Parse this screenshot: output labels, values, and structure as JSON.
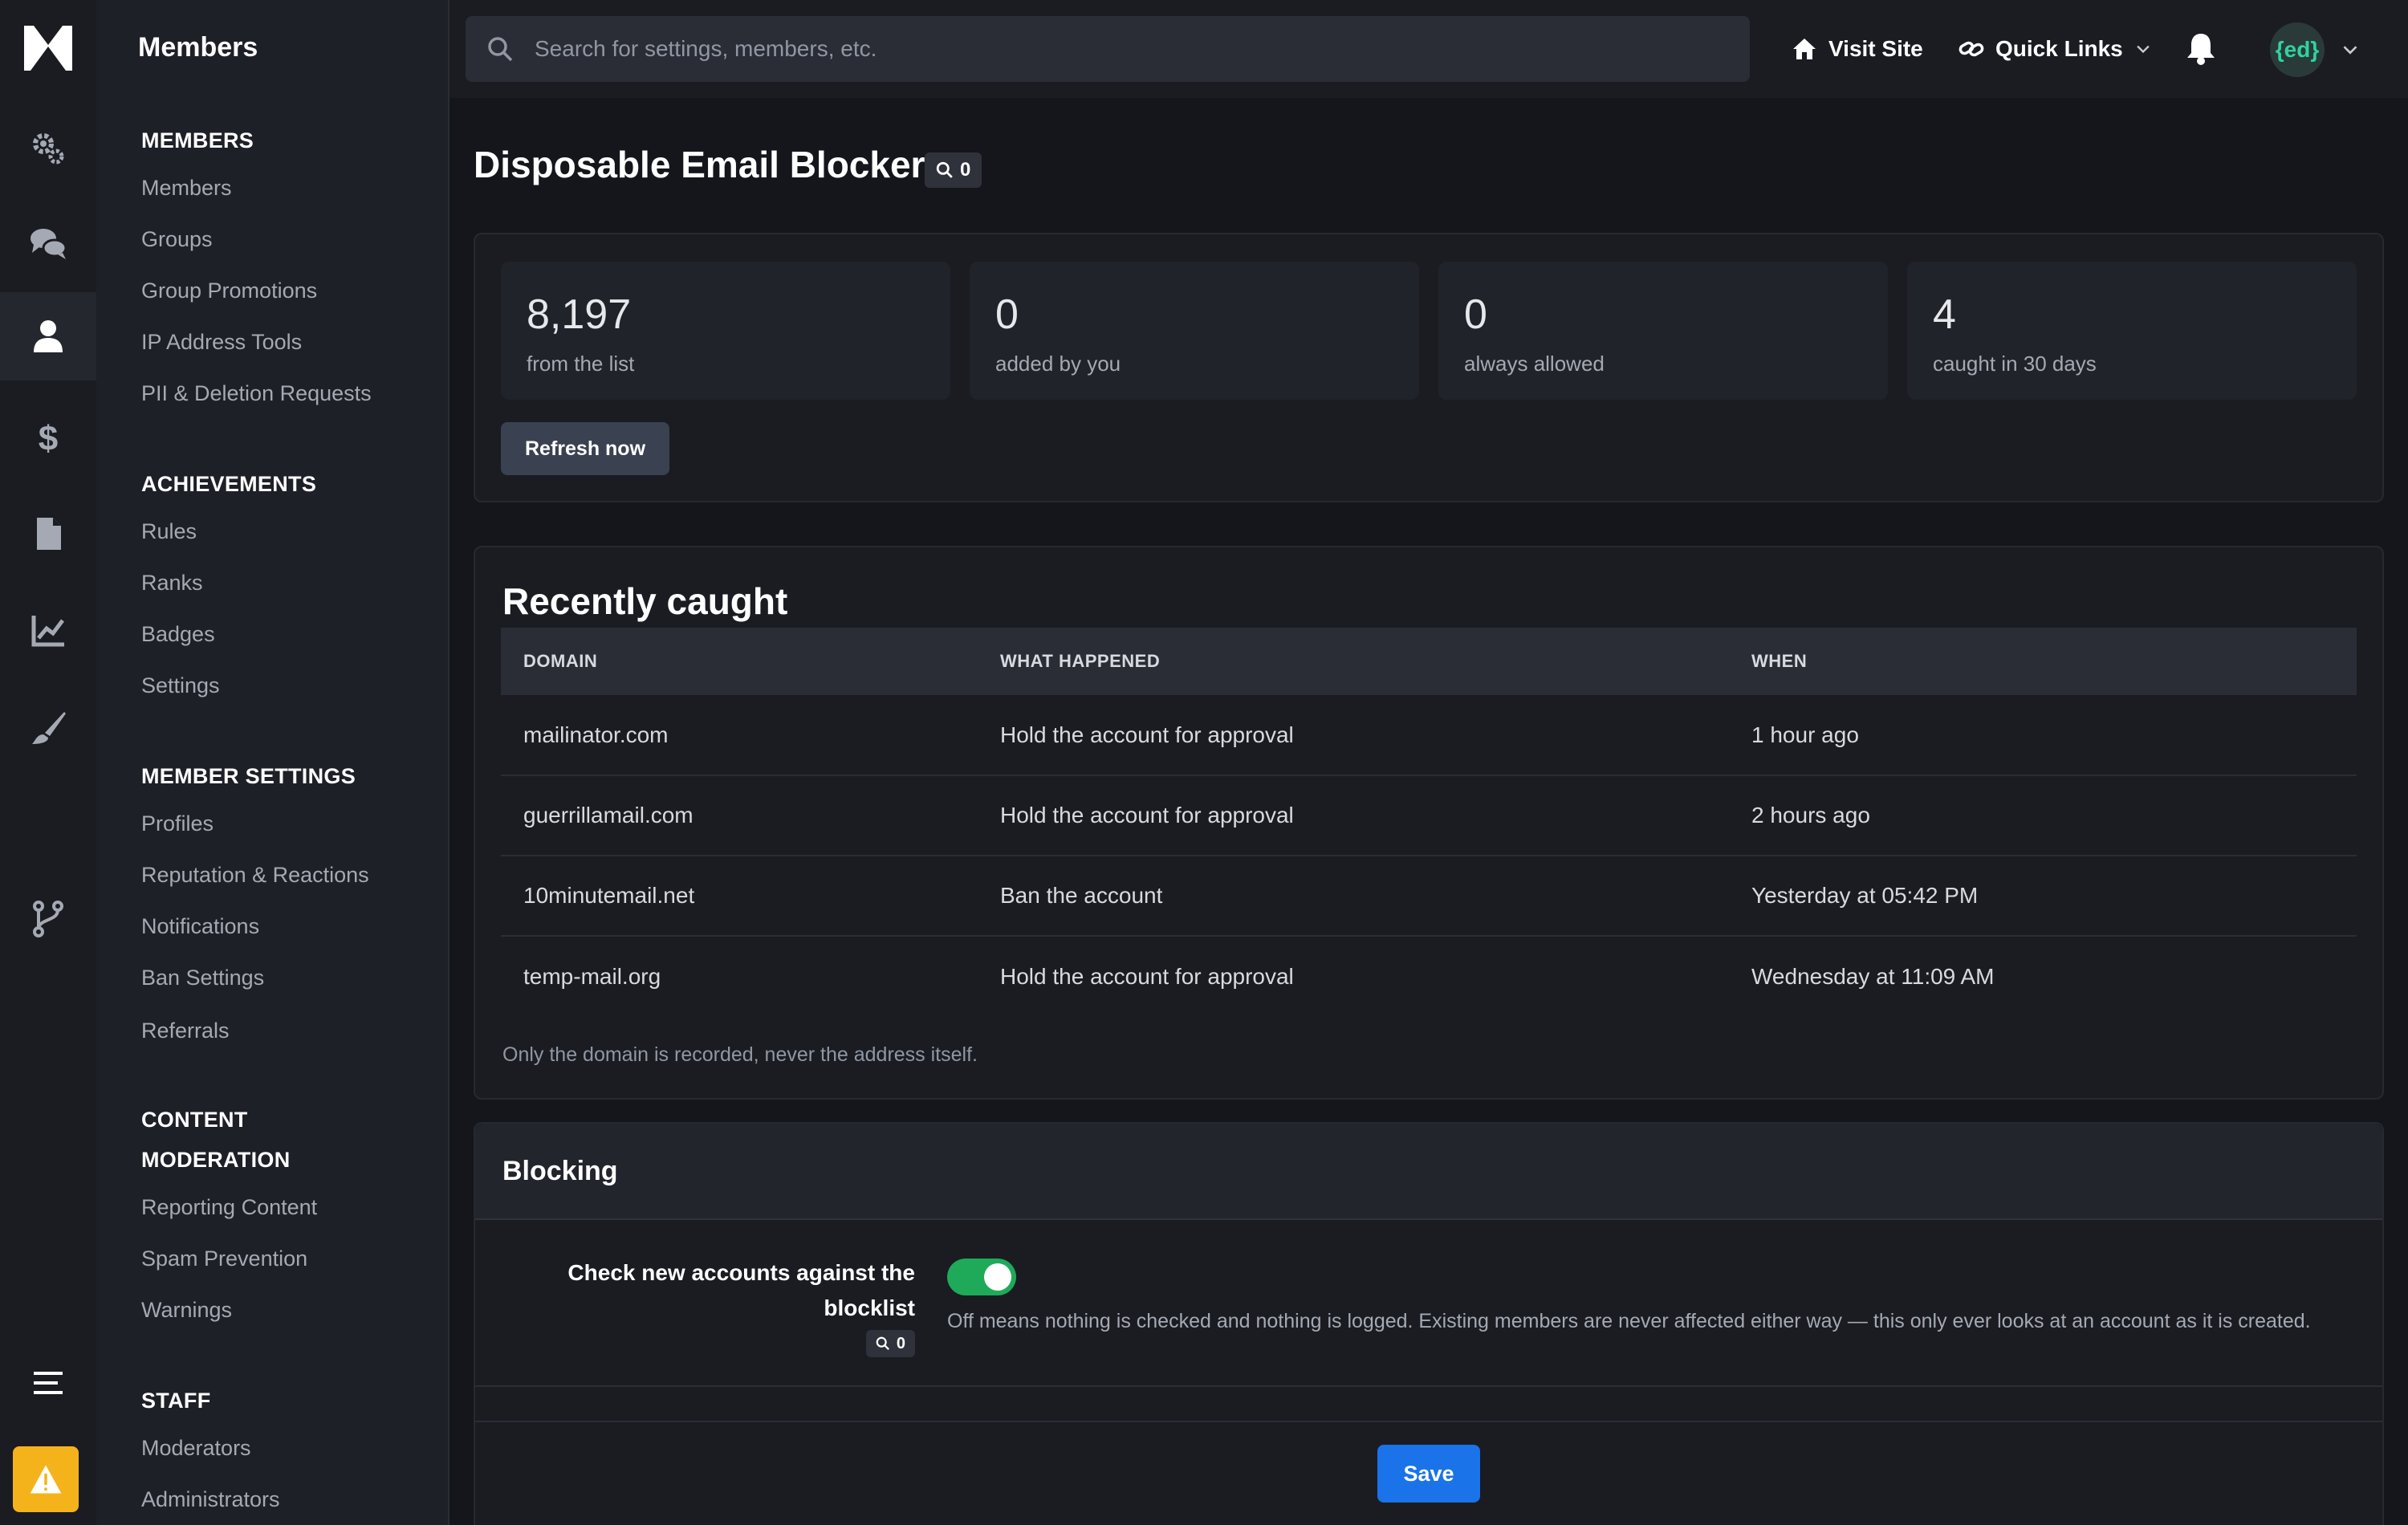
{
  "sidebar": {
    "title": "Members",
    "sections": [
      {
        "heading": "MEMBERS",
        "items": [
          "Members",
          "Groups",
          "Group Promotions",
          "IP Address Tools",
          "PII & Deletion Requests"
        ]
      },
      {
        "heading": "ACHIEVEMENTS",
        "items": [
          "Rules",
          "Ranks",
          "Badges",
          "Settings"
        ]
      },
      {
        "heading": "MEMBER SETTINGS",
        "items": [
          "Profiles",
          "Reputation & Reactions",
          "Notifications",
          "Ban Settings",
          "Referrals"
        ]
      },
      {
        "heading": "CONTENT MODERATION",
        "items": [
          "Reporting Content",
          "Spam Prevention",
          "Warnings"
        ]
      },
      {
        "heading": "STAFF",
        "items": [
          "Moderators",
          "Administrators"
        ]
      }
    ]
  },
  "rail": {
    "icons": [
      "logo-icon",
      "gears-icon",
      "chat-icon",
      "user-icon",
      "dollar-icon",
      "file-icon",
      "chart-icon",
      "brush-icon",
      "branch-icon",
      "menu-icon",
      "warning-icon"
    ],
    "active": "user-icon",
    "alert_color": "#f5b31b"
  },
  "topbar": {
    "search_placeholder": "Search for settings, members, etc.",
    "visit_site": "Visit Site",
    "quick_links": "Quick Links",
    "avatar_text": "{ed}"
  },
  "page": {
    "title": "Disposable Email Blocker",
    "title_badge_count": "0"
  },
  "stats": [
    {
      "value": "8,197",
      "label": "from the list"
    },
    {
      "value": "0",
      "label": "added by you"
    },
    {
      "value": "0",
      "label": "always allowed"
    },
    {
      "value": "4",
      "label": "caught in 30 days"
    }
  ],
  "refresh_label": "Refresh now",
  "recent": {
    "heading": "Recently caught",
    "columns": [
      "DOMAIN",
      "WHAT HAPPENED",
      "WHEN"
    ],
    "rows": [
      [
        "mailinator.com",
        "Hold the account for approval",
        "1 hour ago"
      ],
      [
        "guerrillamail.com",
        "Hold the account for approval",
        "2 hours ago"
      ],
      [
        "10minutemail.net",
        "Ban the account",
        "Yesterday at 05:42 PM"
      ],
      [
        "temp-mail.org",
        "Hold the account for approval",
        "Wednesday at 11:09 AM"
      ]
    ],
    "footnote": "Only the domain is recorded, never the address itself."
  },
  "blocking": {
    "heading": "Blocking",
    "setting_label": "Check new accounts against the blocklist",
    "setting_badge_count": "0",
    "setting_enabled": true,
    "setting_help": "Off means nothing is checked and nothing is logged. Existing members are never affected either way — this only ever looks at an account as it is created."
  },
  "save_label": "Save",
  "colors": {
    "accent": "#1a73e8",
    "toggle_on": "#1faa59",
    "background": "#14161b"
  }
}
